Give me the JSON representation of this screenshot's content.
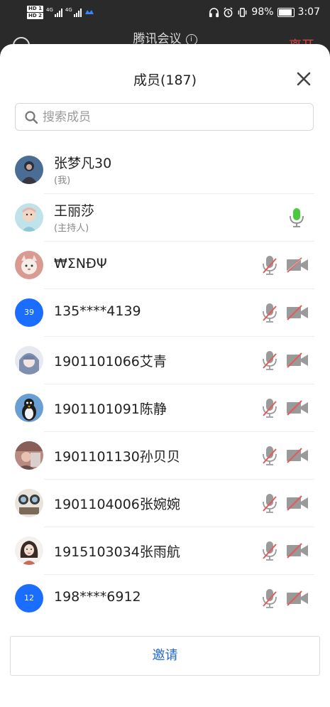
{
  "status_bar": {
    "hd1": "HD 1",
    "hd2": "HD 2",
    "net1": "4G",
    "net2": "4G",
    "battery_pct": "98%",
    "time": "3:07"
  },
  "header": {
    "meeting_title": "腾讯会议",
    "leave_label": "离开"
  },
  "sheet": {
    "title": "成员(187)",
    "search_placeholder": "搜索成员"
  },
  "members": [
    {
      "name": "张梦凡30",
      "role": "(我)",
      "avatar": "photo",
      "mic": "none",
      "cam": "none"
    },
    {
      "name": "王丽莎",
      "role": "(主持人)",
      "avatar": "photo",
      "mic": "active",
      "cam": "none"
    },
    {
      "name": "₩ΣΝĐΨ",
      "avatar": "photo",
      "mic": "muted",
      "cam": "off"
    },
    {
      "name": "135****4139",
      "avatar_text": "39",
      "avatar": "initials",
      "mic": "muted",
      "cam": "off"
    },
    {
      "name": "1901101066艾青",
      "avatar": "photo",
      "mic": "muted",
      "cam": "off"
    },
    {
      "name": "1901101091陈静",
      "avatar": "photo",
      "mic": "muted",
      "cam": "off"
    },
    {
      "name": "1901101130孙贝贝",
      "avatar": "photo",
      "mic": "muted",
      "cam": "off"
    },
    {
      "name": "1901104006张婉婉",
      "avatar": "photo",
      "mic": "muted",
      "cam": "off"
    },
    {
      "name": "1915103034张雨航",
      "avatar": "photo",
      "mic": "muted",
      "cam": "off"
    },
    {
      "name": "198****6912",
      "avatar_text": "12",
      "avatar": "initials",
      "mic": "muted",
      "cam": "off"
    }
  ],
  "invite_label": "邀请",
  "colors": {
    "accent": "#2468c9",
    "mic_active": "#49c93c",
    "muted_red": "#e45a5a",
    "leave_red": "#e64545",
    "initials_bg": "#1a6dff"
  }
}
